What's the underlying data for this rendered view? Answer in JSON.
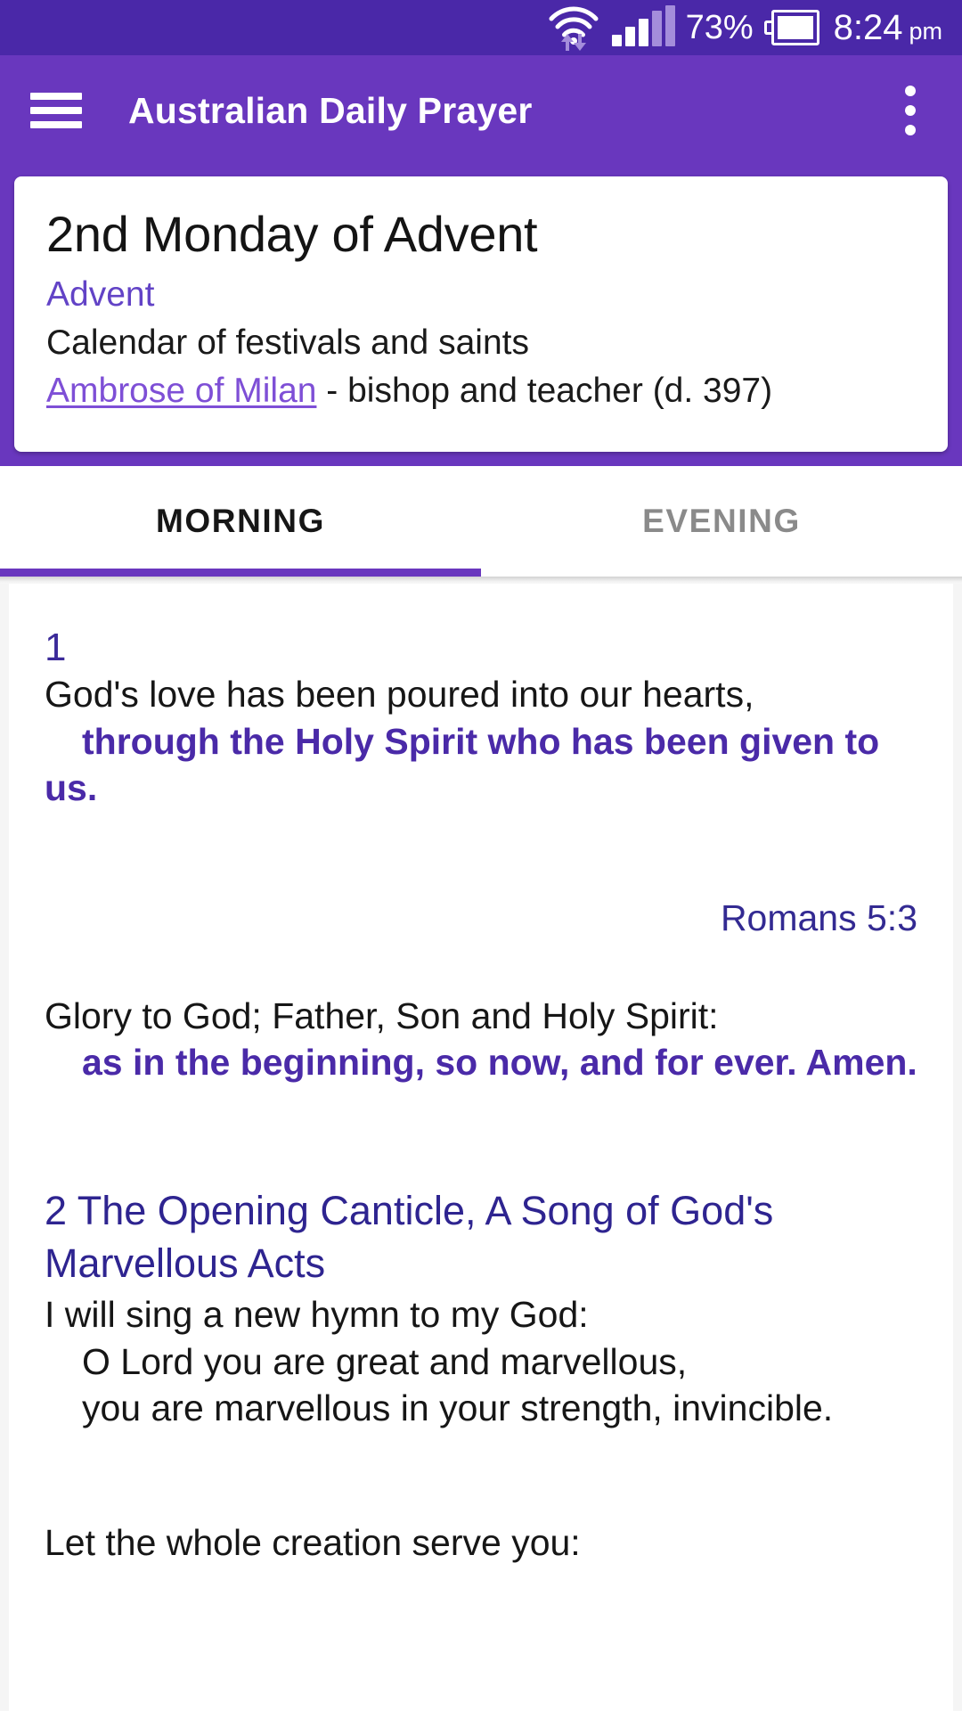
{
  "status_bar": {
    "wifi_icon": "wifi-icon",
    "data_transfer_icon": "data-transfer-arrows-icon",
    "signal_icon": "cell-signal-icon",
    "battery_percent": "73%",
    "battery_icon": "battery-icon",
    "time": "8:24",
    "am_pm": "pm"
  },
  "app_bar": {
    "menu_icon": "hamburger-menu-icon",
    "title": "Australian Daily Prayer",
    "overflow_icon": "overflow-menu-icon"
  },
  "header_card": {
    "title": "2nd Monday of Advent",
    "season": "Advent",
    "calendar_label": "Calendar of festivals and saints",
    "saint_link": "Ambrose of Milan",
    "saint_detail": " - bishop and teacher (d. 397)"
  },
  "tabs": [
    {
      "label": "MORNING",
      "active": true
    },
    {
      "label": "EVENING",
      "active": false
    }
  ],
  "content": {
    "section1": {
      "number": "1",
      "versicle": "God's love has been poured into our hearts,",
      "response": "through the Holy Spirit who has been given to us.",
      "reference": "Romans 5:3",
      "gloria_versicle": "Glory to God; Father, Son and Holy Spirit:",
      "gloria_response": "as in the beginning, so now, and for ever. Amen."
    },
    "section2": {
      "heading": "2 The Opening Canticle, A Song of God's Marvellous Acts",
      "line1": "I will sing a new hymn to my God:",
      "line2": "O Lord you are great and marvellous,",
      "line3": "you are marvellous in your strength, invincible.",
      "line4": "Let the whole creation serve you:"
    }
  },
  "colors": {
    "status_bar": "#4a28a8",
    "app_bar": "#6937be",
    "accent": "#6937be",
    "link": "#7e4fd6",
    "response_text": "#4a2aa8",
    "heading_text": "#2e2490"
  }
}
